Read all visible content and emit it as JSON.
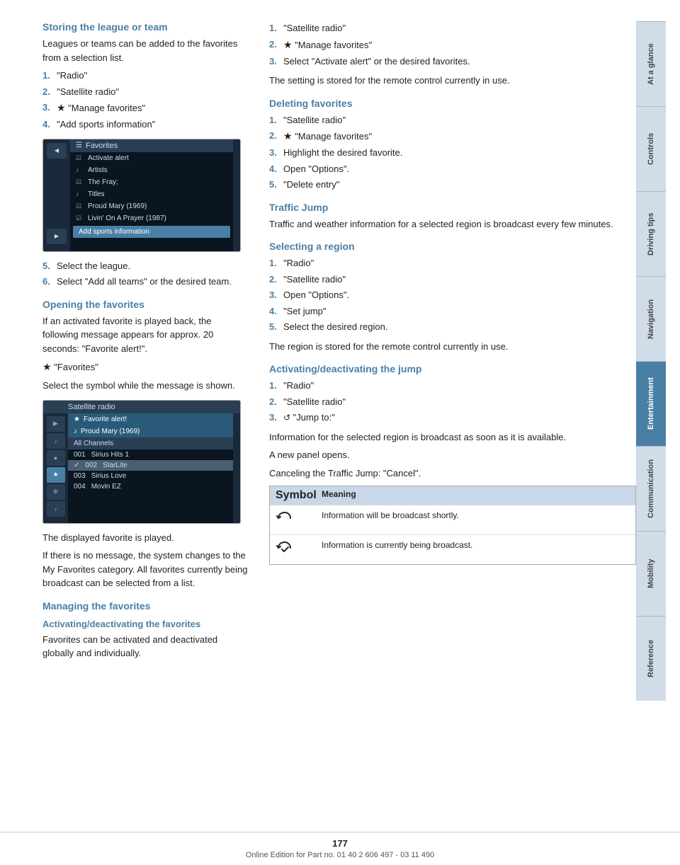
{
  "page": {
    "number": "177",
    "footer_text": "Online Edition for Part no. 01 40 2 606 497 - 03 11 490"
  },
  "sidebar": {
    "tabs": [
      {
        "id": "at-a-glance",
        "label": "At a glance",
        "active": false
      },
      {
        "id": "controls",
        "label": "Controls",
        "active": false
      },
      {
        "id": "driving-tips",
        "label": "Driving tips",
        "active": false
      },
      {
        "id": "navigation",
        "label": "Navigation",
        "active": false
      },
      {
        "id": "entertainment",
        "label": "Entertainment",
        "active": true
      },
      {
        "id": "communication",
        "label": "Communication",
        "active": false
      },
      {
        "id": "mobility",
        "label": "Mobility",
        "active": false
      },
      {
        "id": "reference",
        "label": "Reference",
        "active": false
      }
    ]
  },
  "left_column": {
    "section1": {
      "heading": "Storing the league or team",
      "intro": "Leagues or teams can be added to the favorites from a selection list.",
      "steps": [
        {
          "num": "1.",
          "text": "\"Radio\""
        },
        {
          "num": "2.",
          "text": "\"Satellite radio\""
        },
        {
          "num": "3.",
          "icon": "★",
          "text": "\"Manage favorites\""
        },
        {
          "num": "4.",
          "text": "\"Add sports information\""
        }
      ],
      "screenshot_favorites": {
        "title": "Favorites",
        "items": [
          {
            "icon": "☑",
            "text": "Activate alert"
          },
          {
            "icon": "♪",
            "text": "Artists"
          },
          {
            "icon": "☑",
            "text": "The Fray;"
          },
          {
            "icon": "♪",
            "text": "Titles"
          },
          {
            "icon": "☑",
            "text": "Proud Mary (1969)"
          },
          {
            "icon": "☑",
            "text": "Livin' On A Prayer (1987)"
          }
        ],
        "add_sports": "Add sports information"
      },
      "steps2": [
        {
          "num": "5.",
          "text": "Select the league."
        },
        {
          "num": "6.",
          "text": "Select \"Add all teams\" or the desired team."
        }
      ]
    },
    "section2": {
      "heading": "Opening the favorites",
      "body1": "If an activated favorite is played back, the following message appears for approx. 20 seconds: \"Favorite alert!\".",
      "icon_line": "★",
      "icon_text": "\"Favorites\"",
      "body2": "Select the symbol while the message is shown.",
      "screenshot_satellite": {
        "title": "Satellite radio",
        "favorite_alert": "Favorite alert!",
        "proud_mary": "Proud Mary (1969)",
        "channel_header": "All Channels",
        "channels": [
          {
            "num": "001",
            "name": "Sirius Hits 1"
          },
          {
            "num": "002",
            "name": "StarLite"
          },
          {
            "num": "003",
            "name": "Sirius Love"
          },
          {
            "num": "004",
            "name": "Movin EZ"
          }
        ]
      },
      "body3": "The displayed favorite is played.",
      "body4": "If there is no message, the system changes to the My Favorites category. All favorites currently being broadcast can be selected from a list."
    },
    "section3": {
      "heading": "Managing the favorites",
      "subheading": "Activating/deactivating the favorites",
      "body": "Favorites can be activated and deactivated globally and individually."
    }
  },
  "right_column": {
    "activating_steps": [
      {
        "num": "1.",
        "text": "\"Satellite radio\""
      },
      {
        "num": "2.",
        "icon": "★",
        "text": "\"Manage favorites\""
      },
      {
        "num": "3.",
        "text": "Select \"Activate alert\" or the desired favorites."
      }
    ],
    "activating_note": "The setting is stored for the remote control currently in use.",
    "section_deleting": {
      "heading": "Deleting favorites",
      "steps": [
        {
          "num": "1.",
          "text": "\"Satellite radio\""
        },
        {
          "num": "2.",
          "icon": "★",
          "text": "\"Manage favorites\""
        },
        {
          "num": "3.",
          "text": "Highlight the desired favorite."
        },
        {
          "num": "4.",
          "text": "Open \"Options\"."
        },
        {
          "num": "5.",
          "text": "\"Delete entry\""
        }
      ]
    },
    "section_traffic": {
      "heading": "Traffic Jump",
      "body": "Traffic and weather information for a selected region is broadcast every few minutes."
    },
    "section_selecting": {
      "heading": "Selecting a region",
      "steps": [
        {
          "num": "1.",
          "text": "\"Radio\""
        },
        {
          "num": "2.",
          "text": "\"Satellite radio\""
        },
        {
          "num": "3.",
          "text": "Open \"Options\"."
        },
        {
          "num": "4.",
          "text": "\"Set jump\""
        },
        {
          "num": "5.",
          "text": "Select the desired region."
        }
      ],
      "note": "The region is stored for the remote control currently in use."
    },
    "section_activating_jump": {
      "heading": "Activating/deactivating the jump",
      "steps": [
        {
          "num": "1.",
          "text": "\"Radio\""
        },
        {
          "num": "2.",
          "text": "\"Satellite radio\""
        },
        {
          "num": "3.",
          "icon": "↺",
          "text": "\"Jump to:\""
        }
      ],
      "notes": [
        "Information for the selected region is broadcast as soon as it is available.",
        "A new panel opens.",
        "Canceling the Traffic Jump: \"Cancel\"."
      ],
      "table": {
        "headers": [
          "Symbol",
          "Meaning"
        ],
        "rows": [
          {
            "symbol": "↺",
            "meaning": "Information will be broadcast shortly."
          },
          {
            "symbol": "↺✓",
            "meaning": "Information is currently being broadcast."
          }
        ]
      }
    }
  }
}
